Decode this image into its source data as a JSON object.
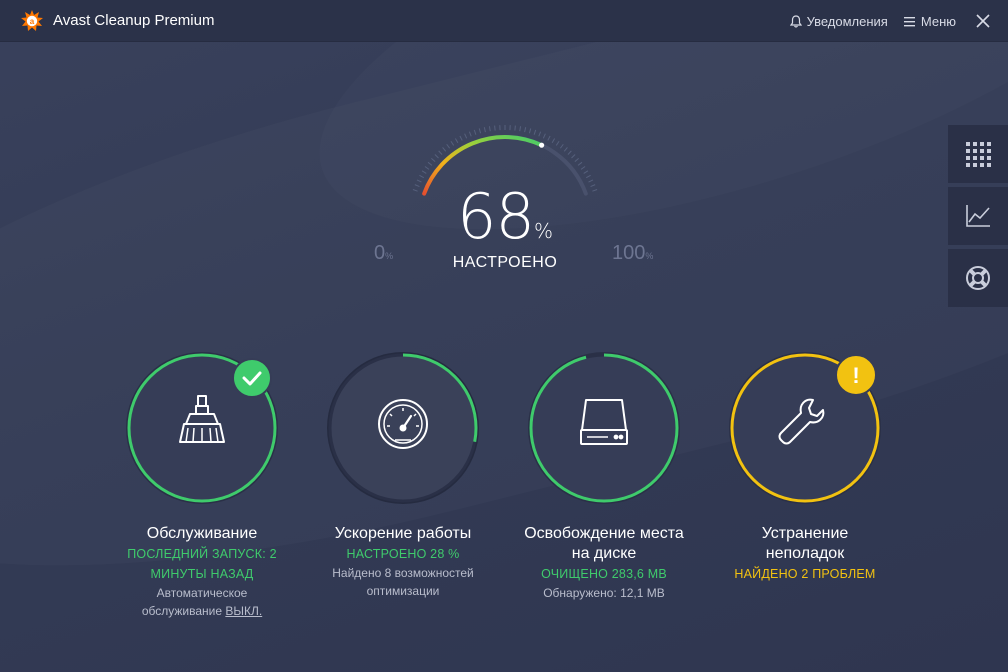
{
  "app": {
    "title": "Avast Cleanup Premium",
    "notifications_label": "Уведомления",
    "menu_label": "Меню"
  },
  "gauge": {
    "value": "68",
    "unit": "%",
    "status": "НАСТРОЕНО",
    "min_label": "0",
    "max_label": "100",
    "percent_sign": "%",
    "fraction": 0.68
  },
  "tiles": [
    {
      "label": "Обслуживание",
      "status_lines": [
        "ПОСЛЕДНИЙ ЗАПУСК: 2",
        "МИНУТЫ НАЗАД"
      ],
      "detail_lines": [
        "Автоматическое",
        "обслуживание"
      ],
      "detail_link": "ВЫКЛ.",
      "progress": 1.0,
      "badge": "check"
    },
    {
      "label": "Ускорение работы",
      "status_lines": [
        "НАСТРОЕНО 28 %"
      ],
      "detail_lines": [
        "Найдено 8 возможностей",
        "оптимизации"
      ],
      "progress": 0.28
    },
    {
      "label_lines": [
        "Освобождение места",
        "на диске"
      ],
      "status_lines": [
        "ОЧИЩЕНО 283,6 MB"
      ],
      "detail_lines": [
        "Обнаружено: 12,1 MB"
      ],
      "progress": 0.96
    },
    {
      "label_lines": [
        "Устранение",
        "неполадок"
      ],
      "status_lines": [
        "НАЙДЕНО 2 ПРОБЛЕМ"
      ],
      "progress": 1.0,
      "badge": "warning",
      "badge_text": "!"
    }
  ],
  "colors": {
    "accent_green": "#3fcb6c",
    "accent_yellow": "#f2c211",
    "background": "#333b55"
  },
  "icons": {
    "logo": "avast-logo-icon",
    "notifications": "bell-icon",
    "menu": "hamburger-icon",
    "close": "close-icon",
    "side": [
      "grid-icon",
      "chart-icon",
      "lifebuoy-icon"
    ],
    "tiles": [
      "broom-icon",
      "speedometer-icon",
      "hard-drive-icon",
      "wrench-icon"
    ]
  }
}
